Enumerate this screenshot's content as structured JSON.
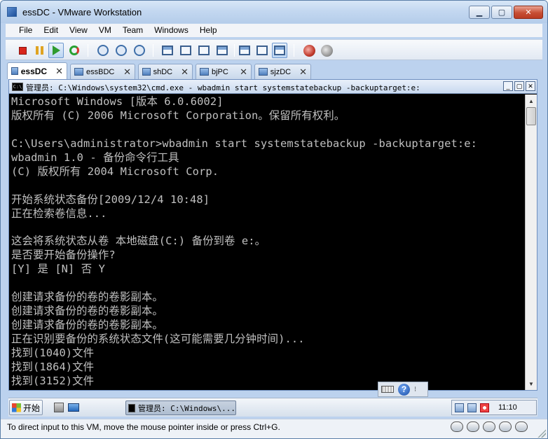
{
  "window": {
    "title": "essDC - VMware Workstation"
  },
  "menu": [
    "File",
    "Edit",
    "View",
    "VM",
    "Team",
    "Windows",
    "Help"
  ],
  "toolbar_icons": [
    "stop-icon",
    "pause-icon",
    "play-icon",
    "reset-icon",
    "snapshot-icon",
    "revert-snapshot-icon",
    "snapshot-manager-icon",
    "normal-view-icon",
    "fullscreen-icon",
    "quick-switch-icon",
    "unity-icon",
    "summary-icon",
    "console-view-icon",
    "network-icon",
    "team-icon"
  ],
  "tabs": [
    {
      "label": "essDC",
      "active": true
    },
    {
      "label": "essBDC",
      "active": false
    },
    {
      "label": "shDC",
      "active": false
    },
    {
      "label": "bjPC",
      "active": false
    },
    {
      "label": "sjzDC",
      "active": false
    }
  ],
  "console": {
    "icon_text": "C:\\",
    "title": "管理员: C:\\Windows\\system32\\cmd.exe - wbadmin  start systemstatebackup -backuptarget:e:",
    "lines": [
      "Microsoft Windows [版本 6.0.6002]",
      "版权所有 (C) 2006 Microsoft Corporation。保留所有权利。",
      "",
      "C:\\Users\\administrator>wbadmin start systemstatebackup -backuptarget:e:",
      "wbadmin 1.0 - 备份命令行工具",
      "(C) 版权所有 2004 Microsoft Corp.",
      "",
      "开始系统状态备份[2009/12/4 10:48]",
      "正在检索卷信息...",
      "",
      "这会将系统状态从卷 本地磁盘(C:) 备份到卷 e:。",
      "是否要开始备份操作?",
      "[Y] 是 [N] 否 Y",
      "",
      "创建请求备份的卷的卷影副本。",
      "创建请求备份的卷的卷影副本。",
      "创建请求备份的卷的卷影副本。",
      "正在识别要备份的系统状态文件(这可能需要几分钟时间)...",
      "找到(1040)文件",
      "找到(1864)文件",
      "找到(3152)文件"
    ]
  },
  "guest_taskbar": {
    "start_label": "开始",
    "task_label": "管理员: C:\\Windows\\...",
    "clock": "11:10"
  },
  "status": {
    "text": "To direct input to this VM, move the mouse pointer inside or press Ctrl+G."
  }
}
